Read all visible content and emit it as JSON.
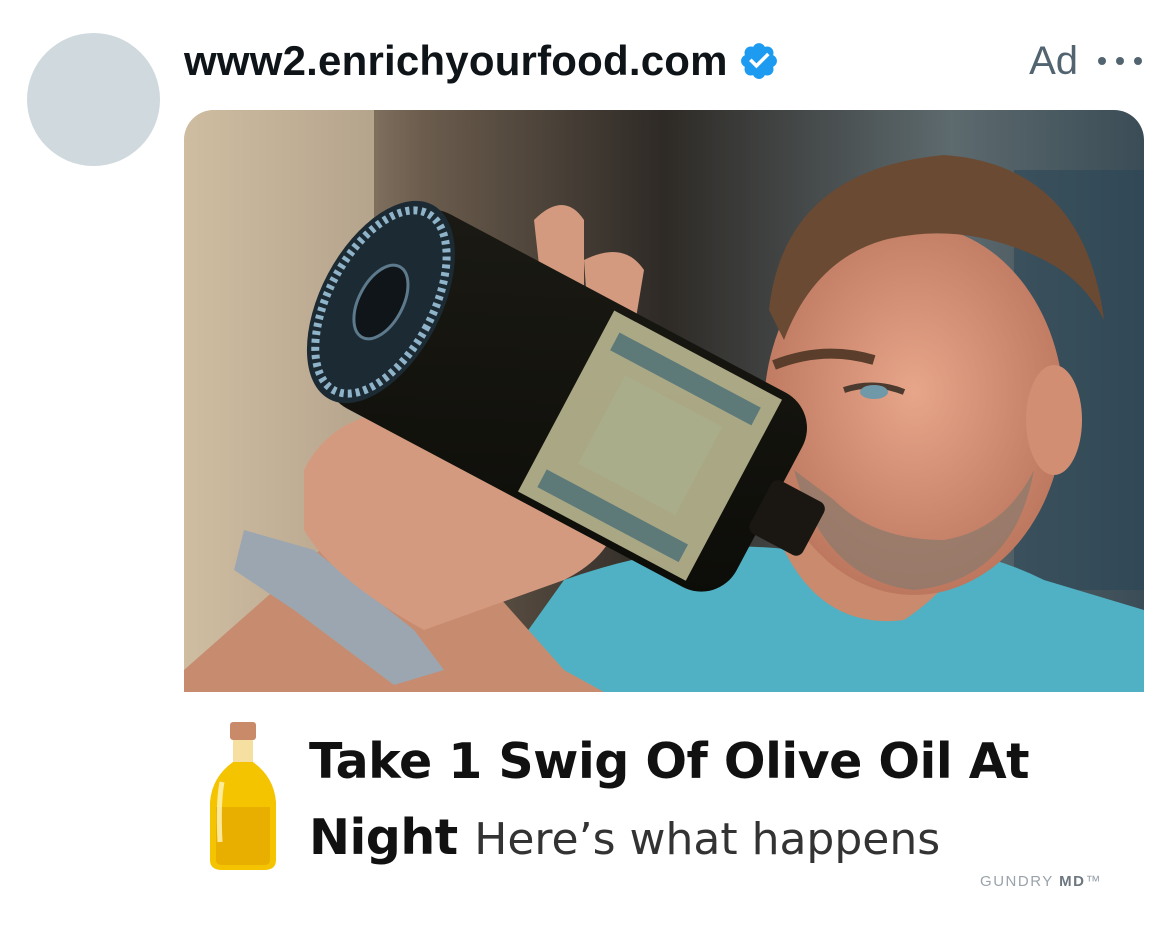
{
  "tweet": {
    "handle": "www2.enrichyourfood.com",
    "ad_label": "Ad",
    "more_icon": "ellipsis-icon",
    "verified_icon": "verified-badge-icon",
    "avatar_color": "#cfd9de",
    "verified_color": "#1d9bf0"
  },
  "card": {
    "headline_bold": "Take 1 Swig Of Olive Oil At Night",
    "headline_sub": "Here’s what happens",
    "brand_light": "GUNDRY",
    "brand_bold": "MD",
    "brand_tm": "™",
    "bottle_icon": "olive-oil-bottle-icon",
    "photo_subject": "photo"
  }
}
